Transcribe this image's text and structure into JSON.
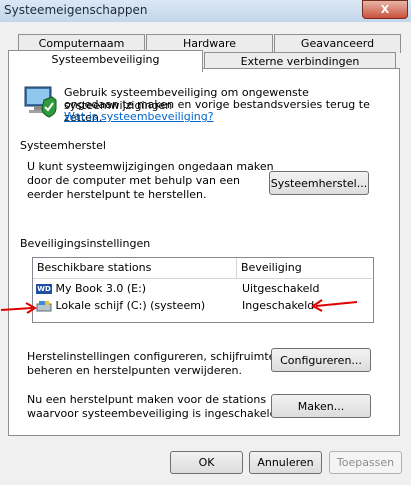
{
  "window": {
    "title": "Systeemeigenschappen",
    "close_glyph": "X"
  },
  "tabs": {
    "row_back": [
      "Computernaam",
      "Hardware",
      "Geavanceerd"
    ],
    "row_front": [
      "Systeembeveiliging",
      "Externe verbindingen"
    ],
    "active": "Systeembeveiliging"
  },
  "intro": {
    "line1": "Gebruik systeembeveiliging om ongewenste systeemwijzigingen",
    "line2": "ongedaan te maken en vorige bestandsversies terug te zetten.",
    "link": "Wat is systeembeveiliging?"
  },
  "restore_section": {
    "header": "Systeemherstel",
    "text_line1": "U kunt systeemwijzigingen ongedaan maken",
    "text_line2": "door de computer met behulp van een",
    "text_line3": "eerder herstelpunt te herstellen.",
    "button": "Systeemherstel..."
  },
  "protection_section": {
    "header": "Beveiligingsinstellingen",
    "columns": [
      "Beschikbare stations",
      "Beveiliging"
    ],
    "rows": [
      {
        "drive": "My Book 3.0 (E:)",
        "status": "Uitgeschakeld",
        "icon": "wd-drive-icon"
      },
      {
        "drive": "Lokale schijf (C:) (systeem)",
        "status": "Ingeschakeld",
        "icon": "system-drive-icon"
      }
    ],
    "configure_line1": "Herstelinstellingen configureren, schijfruimte",
    "configure_line2": "beheren en herstelpunten verwijderen.",
    "configure_button": "Configureren...",
    "create_line1": "Nu een herstelpunt maken voor de stations",
    "create_line2": "waarvoor systeembeveiliging is ingeschakeld.",
    "create_button": "Maken..."
  },
  "footer": {
    "ok": "OK",
    "cancel": "Annuleren",
    "apply": "Toepassen"
  },
  "colors": {
    "annotation_arrow": "#e00000",
    "link": "#0066cc"
  },
  "icons": [
    "shield-computer-icon",
    "wd-drive-icon",
    "system-drive-icon",
    "red-arrow-icon"
  ]
}
